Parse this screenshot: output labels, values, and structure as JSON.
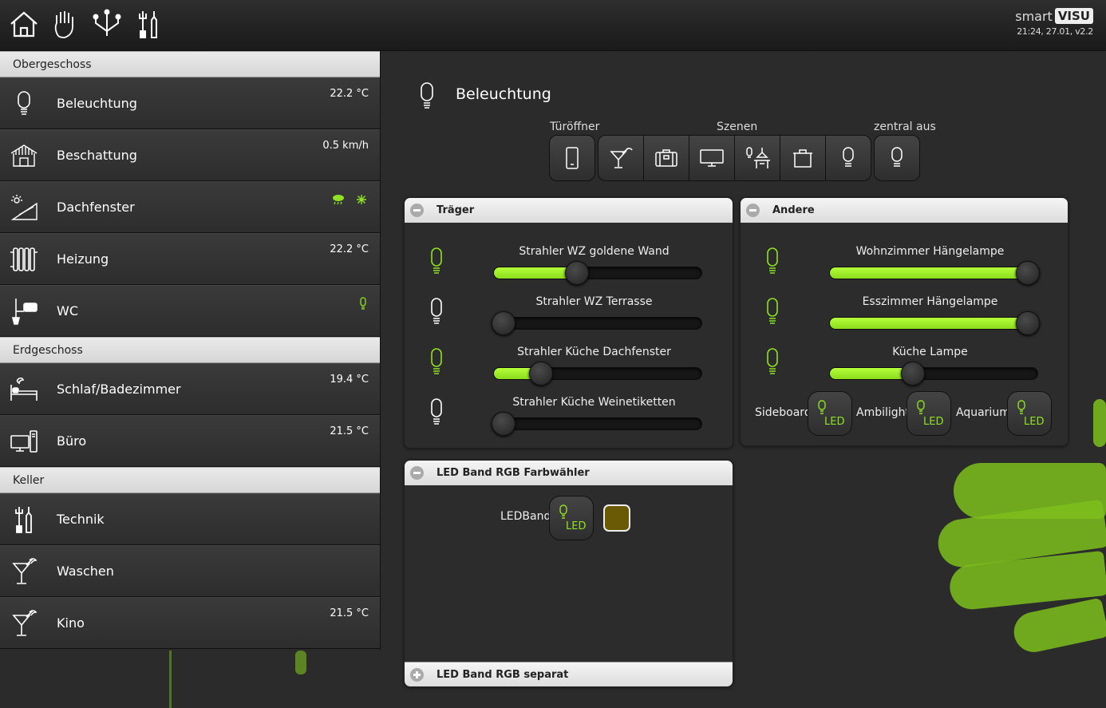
{
  "brand": {
    "smart": "smart",
    "visu": "VISU",
    "version": "21:24, 27.01, v2.2"
  },
  "sidebar": {
    "sections": [
      {
        "label": "Obergeschoss"
      },
      {
        "label": "Erdgeschoss"
      },
      {
        "label": "Keller"
      }
    ],
    "items": [
      {
        "label": "Beleuchtung",
        "value": "22.2 °C",
        "icon": "bulb-icon"
      },
      {
        "label": "Beschattung",
        "value": "0.5 km/h",
        "icon": "blinds-icon"
      },
      {
        "label": "Dachfenster",
        "value": "",
        "icon": "skylight-icon"
      },
      {
        "label": "Heizung",
        "value": "22.2 °C",
        "icon": "radiator-icon"
      },
      {
        "label": "WC",
        "value": "",
        "icon": "toilet-icon"
      },
      {
        "label": "Schlaf/Badezimmer",
        "value": "19.4 °C",
        "icon": "bed-icon"
      },
      {
        "label": "Büro",
        "value": "21.5 °C",
        "icon": "computer-icon"
      },
      {
        "label": "Technik",
        "value": "",
        "icon": "tools-icon"
      },
      {
        "label": "Waschen",
        "value": "",
        "icon": "cocktail-icon"
      },
      {
        "label": "Kino",
        "value": "21.5 °C",
        "icon": "cocktail-icon"
      }
    ]
  },
  "main": {
    "title": "Beleuchtung",
    "labels": {
      "door": "Türöffner",
      "scenes": "Szenen",
      "central": "zentral aus"
    }
  },
  "panels": {
    "traeger": {
      "title": "Träger",
      "sliders": [
        {
          "label": "Strahler WZ goldene Wand",
          "value": 0.39,
          "on": true
        },
        {
          "label": "Strahler WZ Terrasse",
          "value": 0.0,
          "on": false
        },
        {
          "label": "Strahler Küche Dachfenster",
          "value": 0.2,
          "on": true
        },
        {
          "label": "Strahler Küche Weinetiketten",
          "value": 0.0,
          "on": false
        }
      ]
    },
    "andere": {
      "title": "Andere",
      "sliders": [
        {
          "label": "Wohnzimmer Hängelampe",
          "value": 1.0,
          "on": true
        },
        {
          "label": "Esszimmer Hängelampe",
          "value": 1.0,
          "on": true
        },
        {
          "label": "Küche Lampe",
          "value": 0.39,
          "on": true
        }
      ],
      "buttons": [
        {
          "label": "Sideboard",
          "led": "LED"
        },
        {
          "label": "Ambilight",
          "led": "LED"
        },
        {
          "label": "Aquarium",
          "led": "LED"
        }
      ]
    },
    "ledrgb": {
      "title": "LED Band RGB Farbwähler",
      "label": "LEDBand",
      "led": "LED",
      "color": "#6b5a05"
    },
    "ledsep": {
      "title": "LED Band RGB separat"
    }
  },
  "colors": {
    "accent": "#8fe223",
    "background": "#2b2b2b"
  }
}
